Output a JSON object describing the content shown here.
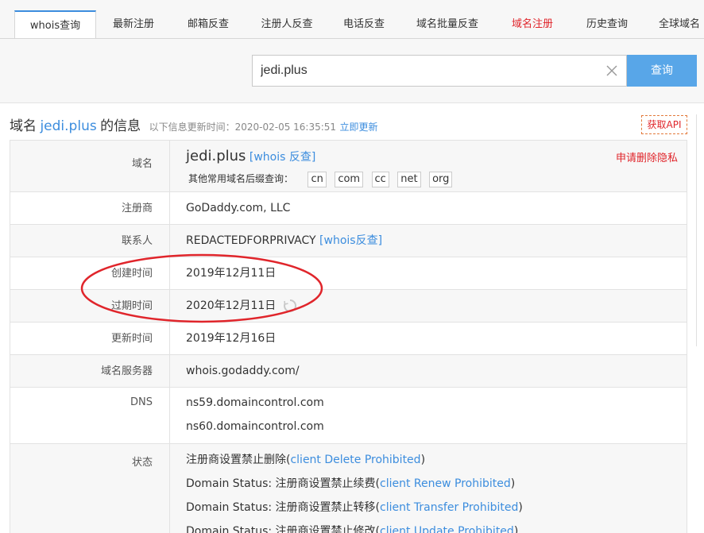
{
  "tabs": [
    {
      "label": "whois查询",
      "active": true
    },
    {
      "label": "最新注册"
    },
    {
      "label": "邮箱反查"
    },
    {
      "label": "注册人反查"
    },
    {
      "label": "电话反查"
    },
    {
      "label": "域名批量反查"
    },
    {
      "label": "域名注册",
      "color": "#e0252b"
    },
    {
      "label": "历史查询"
    },
    {
      "label": "全球域名"
    }
  ],
  "search": {
    "value": "jedi.plus",
    "button_label": "查询"
  },
  "info": {
    "title_prefix": "域名",
    "domain": "jedi.plus",
    "title_suffix": "的信息",
    "update_text": "以下信息更新时间：2020-02-05 16:35:51",
    "update_link": "立即更新",
    "api_button": "获取API"
  },
  "rows": {
    "domain": {
      "label": "域名",
      "value": "jedi.plus",
      "reverse_link": "[whois 反查]",
      "privacy_link": "申请删除隐私",
      "suffix_label": "其他常用域名后缀查询：",
      "suffixes": [
        "cn",
        "com",
        "cc",
        "net",
        "org"
      ]
    },
    "registrar": {
      "label": "注册商",
      "value": "GoDaddy.com, LLC"
    },
    "contact": {
      "label": "联系人",
      "value": "REDACTEDFORPRIVACY",
      "link": "[whois反查]"
    },
    "created": {
      "label": "创建时间",
      "value": "2019年12月11日"
    },
    "expires": {
      "label": "过期时间",
      "value": "2020年12月11日"
    },
    "updated": {
      "label": "更新时间",
      "value": "2019年12月16日"
    },
    "whois_server": {
      "label": "域名服务器",
      "value": "whois.godaddy.com/"
    },
    "dns": {
      "label": "DNS",
      "values": [
        "ns59.domaincontrol.com",
        "ns60.domaincontrol.com"
      ]
    },
    "status": {
      "label": "状态",
      "items": [
        {
          "prefix": "注册商设置禁止删除(",
          "link": "client Delete Prohibited",
          "suffix": ")"
        },
        {
          "prefix": "Domain Status: 注册商设置禁止续费(",
          "link": "client Renew Prohibited",
          "suffix": ")"
        },
        {
          "prefix": "Domain Status: 注册商设置禁止转移(",
          "link": "client Transfer Prohibited",
          "suffix": ")"
        },
        {
          "prefix": "Domain Status: 注册商设置禁止修改(",
          "link": "client Update Prohibited",
          "suffix": ")"
        }
      ]
    }
  },
  "colors": {
    "accent": "#3c8dde",
    "red": "#e0252b",
    "button": "#58a6e8",
    "annotation": "#e0252b"
  }
}
